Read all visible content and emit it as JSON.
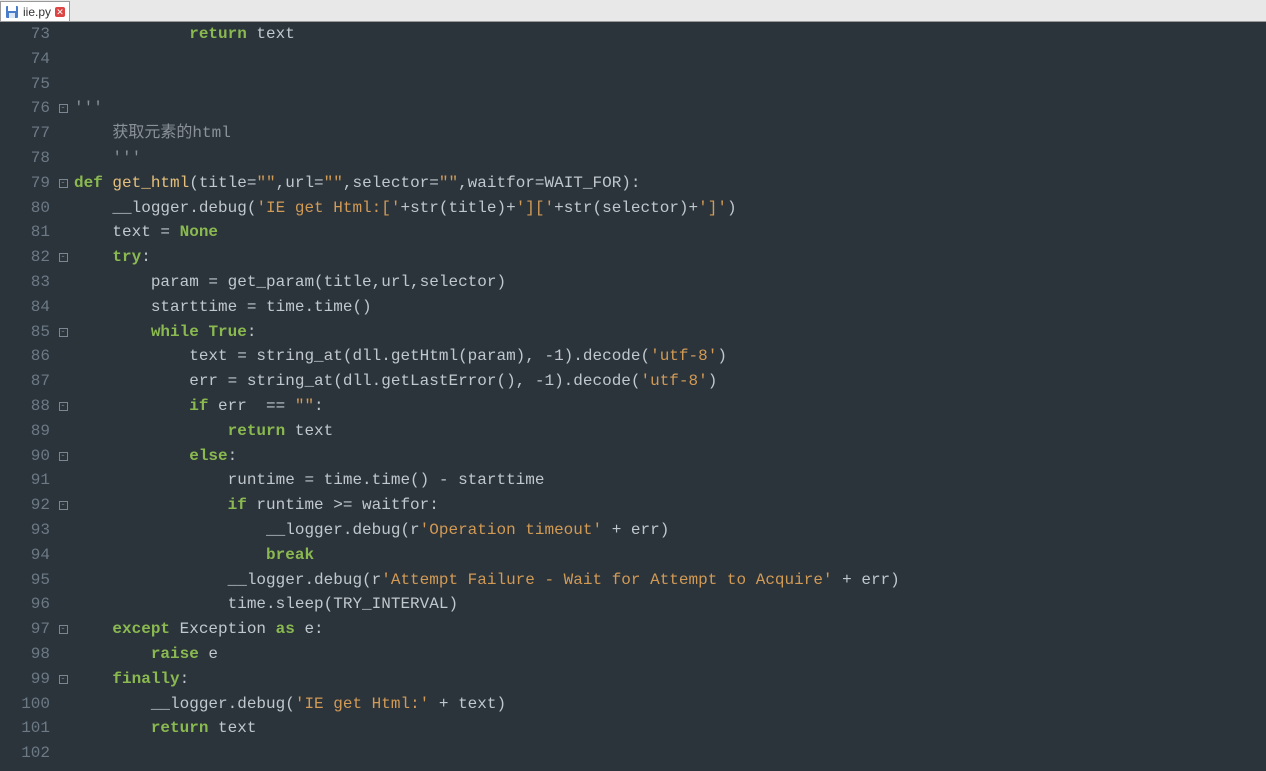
{
  "tab": {
    "filename": "iie.py"
  },
  "lines": {
    "start": 73,
    "end": 102
  },
  "code": {
    "l73": "            return text",
    "l74": "",
    "l75": "",
    "l76": "'''",
    "l77": "    获取元素的html",
    "l78": "    '''",
    "l79_raw": "def get_html(title=\"\",url=\"\",selector=\"\",waitfor=WAIT_FOR):",
    "l79": {
      "def": "def",
      "name": "get_html",
      "params": "(title=",
      "q": "\"\"",
      "c1": ",url=",
      "c2": ",selector=",
      "c3": ",waitfor=WAIT_FOR):"
    },
    "l80": {
      "pre": "    __logger.debug(",
      "s": "'IE get Html:['",
      "mid": "+str(title)+",
      "s2": "']['",
      "mid2": "+str(selector)+",
      "s3": "']'",
      "post": ")"
    },
    "l81": {
      "pre": "    text = ",
      "kw": "None"
    },
    "l82": {
      "kw": "try",
      "post": ":"
    },
    "l83": "        param = get_param(title,url,selector)",
    "l84": "        starttime = time.time()",
    "l85": {
      "pre": "        ",
      "kw": "while",
      "sp": " ",
      "kw2": "True",
      "post": ":"
    },
    "l86": {
      "pre": "            text = string_at(dll.getHtml(param), -1).decode(",
      "s": "'utf-8'",
      "post": ")"
    },
    "l87": {
      "pre": "            err = string_at(dll.getLastError(), -1).decode(",
      "s": "'utf-8'",
      "post": ")"
    },
    "l88": {
      "pre": "            ",
      "kw": "if",
      "mid": " err  == ",
      "s": "\"\"",
      "post": ":"
    },
    "l89": {
      "pre": "                ",
      "kw": "return",
      "post": " text"
    },
    "l90": {
      "pre": "            ",
      "kw": "else",
      "post": ":"
    },
    "l91": "                runtime = time.time() - starttime",
    "l92": {
      "pre": "                ",
      "kw": "if",
      "post": " runtime >= waitfor:"
    },
    "l93": {
      "pre": "                    __logger.debug(r",
      "s": "'Operation timeout'",
      "post": " + err)"
    },
    "l94": {
      "pre": "                    ",
      "kw": "break"
    },
    "l95": {
      "pre": "                __logger.debug(r",
      "s": "'Attempt Failure - Wait for Attempt to Acquire'",
      "post": " + err)"
    },
    "l96": "                time.sleep(TRY_INTERVAL)",
    "l97": {
      "pre": "    ",
      "kw": "except",
      "mid": " Exception ",
      "kw2": "as",
      "post": " e:"
    },
    "l98": {
      "pre": "        ",
      "kw": "raise",
      "post": " e"
    },
    "l99": {
      "pre": "    ",
      "kw": "finally",
      "post": ":"
    },
    "l100": {
      "pre": "        __logger.debug(",
      "s": "'IE get Html:'",
      "post": " + text)"
    },
    "l101": {
      "pre": "        ",
      "kw": "return",
      "post": " text"
    },
    "l102": ""
  },
  "fold_markers": {
    "76": "open",
    "79": "open",
    "82": "open",
    "85": "open",
    "88": "open",
    "90": "open",
    "92": "open",
    "97": "open",
    "99": "open"
  }
}
